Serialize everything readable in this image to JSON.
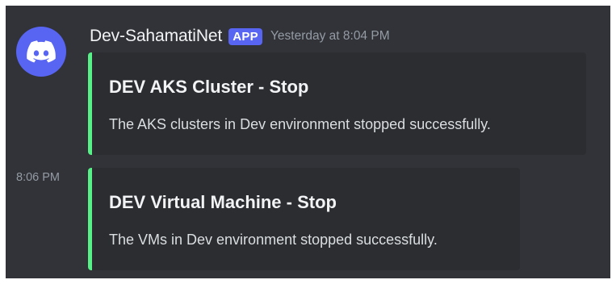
{
  "message": {
    "author": "Dev-SahamatiNet",
    "badge": "APP",
    "timestamp": "Yesterday at 8:04 PM",
    "avatar_icon": "discord-logo-icon",
    "avatar_color": "#5865f2"
  },
  "embeds": [
    {
      "title": "DEV AKS Cluster - Stop",
      "description": "The AKS clusters in Dev environment stopped successfully.",
      "accent_color": "#57f287"
    },
    {
      "timestamp": "8:06 PM",
      "title": "DEV Virtual Machine - Stop",
      "description": "The VMs in Dev environment stopped successfully.",
      "accent_color": "#57f287"
    }
  ],
  "colors": {
    "background": "#313338",
    "embed_background": "#2b2d31",
    "badge": "#5865f2",
    "muted_text": "#949ba4"
  }
}
